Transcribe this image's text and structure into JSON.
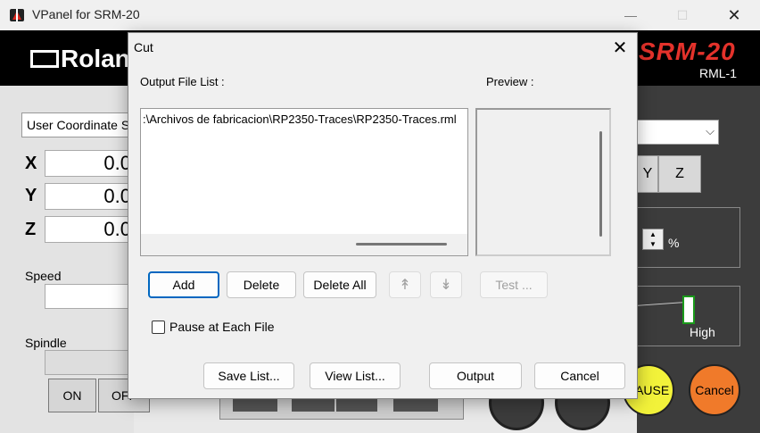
{
  "window": {
    "title": "VPanel for SRM-20",
    "minimize_glyph": "—",
    "maximize_glyph": "☐",
    "close_glyph": "✕"
  },
  "brand": {
    "logo_text": "Roland",
    "model": "SRM-20",
    "sub_model": "RML-1"
  },
  "left_panel": {
    "coordinate_system": "User Coordinate System",
    "axes": [
      {
        "label": "X",
        "value": "0.0"
      },
      {
        "label": "Y",
        "value": "0.0"
      },
      {
        "label": "Z",
        "value": "0.0"
      }
    ],
    "speed_label": "Speed",
    "spindle_label": "Spindle",
    "spindle_on": "ON",
    "spindle_off": "OFF"
  },
  "right_panel": {
    "axis_buttons": [
      "Y",
      "Z"
    ],
    "percent_symbol": "%",
    "high_label": "High",
    "pause_label": "PAUSE",
    "cancel_label": "Cancel",
    "pause_color": "#f2f23a",
    "cancel_color": "#f07a2a"
  },
  "dialog": {
    "title": "Cut",
    "close_glyph": "✕",
    "output_list_label": "Output File List :",
    "preview_label": "Preview :",
    "files": [
      ":\\Archivos de fabricacion\\RP2350-Traces\\RP2350-Traces.rml"
    ],
    "buttons": {
      "add": "Add",
      "delete": "Delete",
      "delete_all": "Delete All",
      "move_up": "↟",
      "move_down": "↡",
      "test": "Test ...",
      "save_list": "Save List...",
      "view_list": "View List...",
      "output": "Output",
      "cancel": "Cancel"
    },
    "pause_checkbox_label": "Pause at Each File",
    "pause_checked": false
  }
}
